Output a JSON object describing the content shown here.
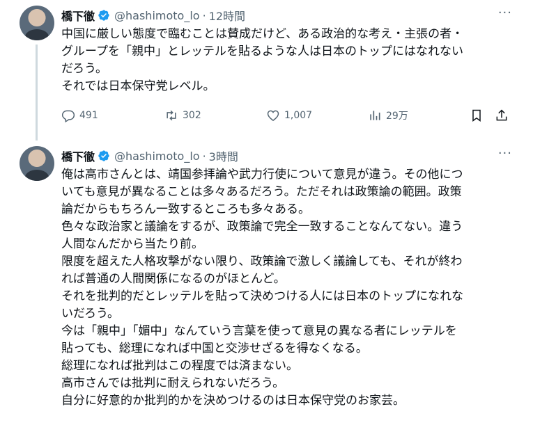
{
  "tweets": [
    {
      "name": "橋下徹",
      "handle": "@hashimoto_lo",
      "separator": "·",
      "time": "12時間",
      "more": "···",
      "lines": [
        "中国に厳しい態度で臨むことは賛成だけど、ある政治的な考え・主張の者・",
        "グループを「親中」とレッテルを貼るような人は日本のトップにはなれない",
        "だろう。",
        "それでは日本保守党レベル。"
      ],
      "replies": "491",
      "reposts": "302",
      "likes": "1,007",
      "views": "29万"
    },
    {
      "name": "橋下徹",
      "handle": "@hashimoto_lo",
      "separator": "·",
      "time": "3時間",
      "more": "···",
      "lines": [
        "俺は高市さんとは、靖国参拝論や武力行使について意見が違う。その他につ",
        "いても意見が異なることは多々あるだろう。ただそれは政策論の範囲。政策",
        "論だからもちろん一致するところも多々ある。",
        "色々な政治家と議論をするが、政策論で完全一致することなんてない。違う",
        "人間なんだから当たり前。",
        "限度を超えた人格攻撃がない限り、政策論で激しく議論しても、それが終わ",
        "れば普通の人間関係になるのがほとんど。",
        "それを批判的だとレッテルを貼って決めつける人には日本のトップになれな",
        "いだろう。",
        "今は「親中」「媚中」なんていう言葉を使って意見の異なる者にレッテルを",
        "貼っても、総理になれば中国と交渉せざるを得なくなる。",
        "総理になれば批判はこの程度では済まない。",
        "高市さんでは批判に耐えられないだろう。",
        "自分に好意的か批判的かを決めつけるのは日本保守党のお家芸。"
      ]
    }
  ]
}
